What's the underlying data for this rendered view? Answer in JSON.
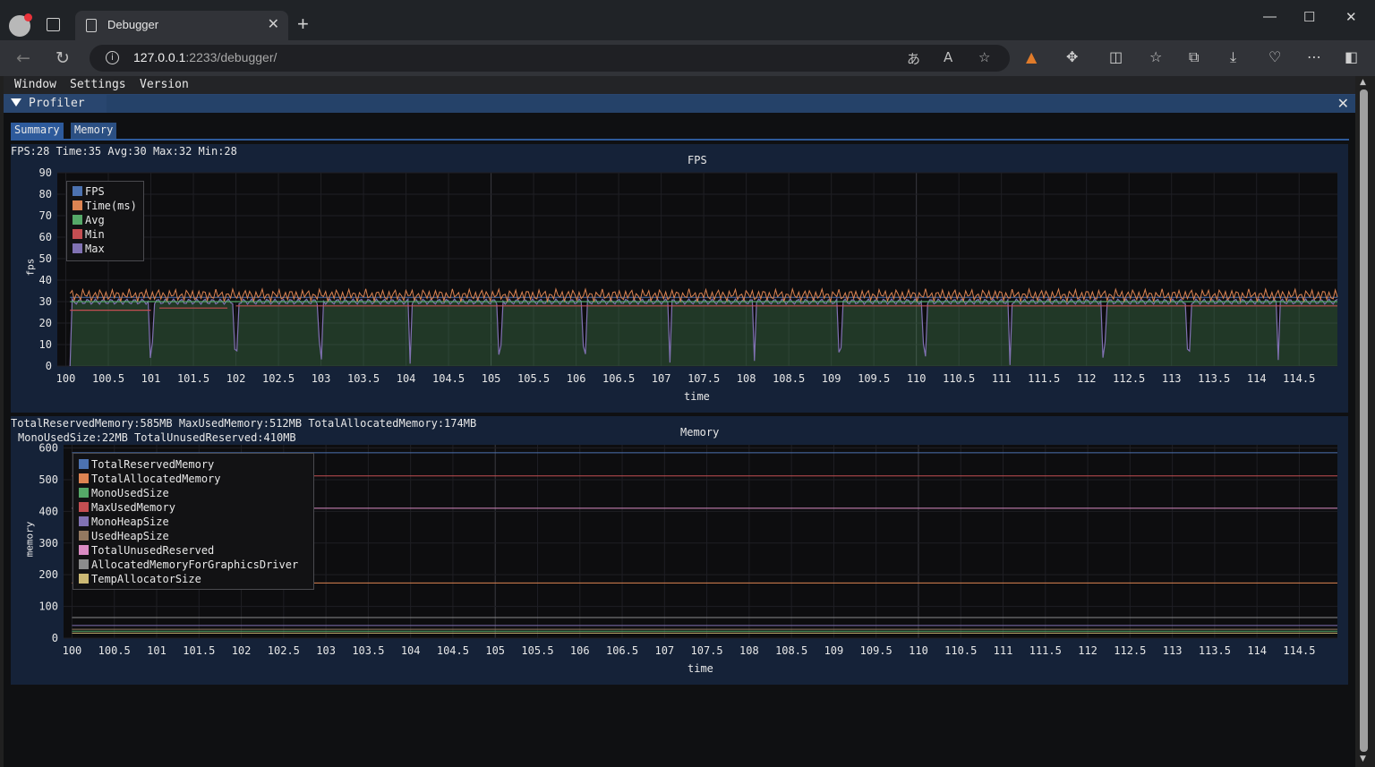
{
  "browser": {
    "tab_title": "Debugger",
    "tab_close": "✕",
    "new_tab": "+",
    "url_host": "127.0.0.1",
    "url_rest": ":2233/debugger/",
    "icons": [
      "profile-icon",
      "tab-actions-icon",
      "document-icon",
      "back-icon",
      "refresh-icon",
      "info-icon",
      "translate-icon",
      "read-aloud-icon",
      "favorite-star-icon",
      "extension-icon",
      "split-screen-icon",
      "favorites-icon",
      "collections-icon",
      "downloads-icon",
      "performance-icon",
      "more-icon",
      "sidebar-icon"
    ],
    "window_controls": [
      "—",
      "☐",
      "✕"
    ]
  },
  "menubar": {
    "items": [
      "Window",
      "Settings",
      "Version"
    ]
  },
  "window": {
    "title": "Profiler",
    "close": "✕"
  },
  "tabs": [
    "Summary",
    "Memory"
  ],
  "fps_panel": {
    "stats": "FPS:28 Time:35 Avg:30 Max:32 Min:28",
    "title": "FPS",
    "ylabel": "fps",
    "xlabel": "time",
    "legend": [
      "FPS",
      "Time(ms)",
      "Avg",
      "Min",
      "Max"
    ]
  },
  "mem_panel": {
    "stats_line1": "TotalReservedMemory:585MB MaxUsedMemory:512MB TotalAllocatedMemory:174MB",
    "stats_line2": "MonoUsedSize:22MB TotalUnusedReserved:410MB",
    "title": "Memory",
    "ylabel": "memory",
    "xlabel": "time",
    "legend": [
      "TotalReservedMemory",
      "TotalAllocatedMemory",
      "MonoUsedSize",
      "MaxUsedMemory",
      "MonoHeapSize",
      "UsedHeapSize",
      "TotalUnusedReserved",
      "AllocatedMemoryForGraphicsDriver",
      "TempAllocatorSize"
    ]
  },
  "colors": {
    "FPS": "#4c72b0",
    "Time": "#dd8452",
    "Avg": "#55a868",
    "Min": "#c44e52",
    "Max": "#8172b3",
    "TotalReservedMemory": "#4c72b0",
    "TotalAllocatedMemory": "#dd8452",
    "MonoUsedSize": "#55a868",
    "MaxUsedMemory": "#c44e52",
    "MonoHeapSize": "#8172b3",
    "UsedHeapSize": "#937860",
    "TotalUnusedReserved": "#da8bc3",
    "AllocatedMemoryForGraphicsDriver": "#8c8c8c",
    "TempAllocatorSize": "#ccb974"
  },
  "chart_data": [
    {
      "type": "line",
      "title": "FPS",
      "xlabel": "time",
      "ylabel": "fps",
      "xlim": [
        99.9,
        114.95
      ],
      "ylim": [
        0,
        90
      ],
      "x_ticks": [
        "100",
        "100.5",
        "101",
        "101.5",
        "102",
        "102.5",
        "103",
        "103.5",
        "104",
        "104.5",
        "105",
        "105.5",
        "106",
        "106.5",
        "107",
        "107.5",
        "108",
        "108.5",
        "109",
        "109.5",
        "110",
        "110.5",
        "111",
        "111.5",
        "112",
        "112.5",
        "113",
        "113.5",
        "114",
        "114.5"
      ],
      "y_ticks": [
        0,
        10,
        20,
        30,
        40,
        50,
        60,
        70,
        80,
        90
      ],
      "grid": true,
      "legend_position": "top-left",
      "series": [
        {
          "name": "FPS",
          "approx": 30,
          "dips_to": 0,
          "dip_times": [
            100.05,
            101,
            102,
            103,
            104.05,
            105.1,
            106.1,
            107.1,
            108.1,
            109.1,
            110.1,
            111.1,
            112.2,
            113.2,
            114.25
          ]
        },
        {
          "name": "Time(ms)",
          "approx": 33,
          "range": [
            30,
            38
          ]
        },
        {
          "name": "Avg",
          "approx": 30
        },
        {
          "name": "Min",
          "values_by_segment": [
            {
              "from": 100.05,
              "to": 101.0,
              "value": 26
            },
            {
              "from": 101.1,
              "to": 101.9,
              "value": 27
            },
            {
              "from": 102.0,
              "to": 114.95,
              "value": 28
            }
          ]
        },
        {
          "name": "Max",
          "approx": 32
        }
      ]
    },
    {
      "type": "line",
      "title": "Memory",
      "xlabel": "time",
      "ylabel": "memory",
      "xlim": [
        99.9,
        114.95
      ],
      "ylim": [
        0,
        610
      ],
      "x_ticks": [
        "100",
        "100.5",
        "101",
        "101.5",
        "102",
        "102.5",
        "103",
        "103.5",
        "104",
        "104.5",
        "105",
        "105.5",
        "106",
        "106.5",
        "107",
        "107.5",
        "108",
        "108.5",
        "109",
        "109.5",
        "110",
        "110.5",
        "111",
        "111.5",
        "112",
        "112.5",
        "113",
        "113.5",
        "114",
        "114.5"
      ],
      "y_ticks": [
        0,
        100,
        200,
        300,
        400,
        500,
        600
      ],
      "grid": true,
      "legend_position": "top-left",
      "series": [
        {
          "name": "TotalReservedMemory",
          "value": 585
        },
        {
          "name": "TotalAllocatedMemory",
          "value": 174
        },
        {
          "name": "MonoUsedSize",
          "value": 22
        },
        {
          "name": "MaxUsedMemory",
          "value": 512
        },
        {
          "name": "MonoHeapSize",
          "value": 40
        },
        {
          "name": "UsedHeapSize",
          "value": 28
        },
        {
          "name": "TotalUnusedReserved",
          "value": 410
        },
        {
          "name": "AllocatedMemoryForGraphicsDriver",
          "value": 65
        },
        {
          "name": "TempAllocatorSize",
          "value": 16
        }
      ]
    }
  ]
}
